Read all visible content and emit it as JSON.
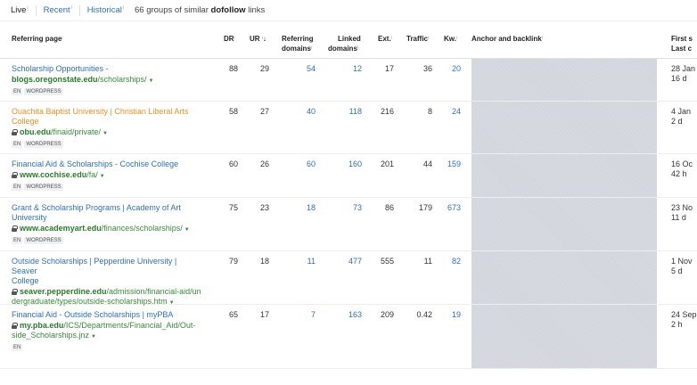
{
  "topbar": {
    "tabs": [
      {
        "label": "Live",
        "info": "i",
        "active": true
      },
      {
        "label": "Recent",
        "info": "i",
        "active": false
      },
      {
        "label": "Historical",
        "info": "i",
        "active": false
      }
    ],
    "summary_prefix": "66 groups of similar",
    "summary_bold": "dofollow",
    "summary_suffix": "links"
  },
  "columns": {
    "referring_page": "Referring page",
    "dr": "DR",
    "ur": "UR",
    "referring_domains_1": "Referring",
    "referring_domains_2": "domains",
    "linked_domains_1": "Linked",
    "linked_domains_2": "domains",
    "ext": "Ext.",
    "traffic": "Traffic",
    "kw": "Kw.",
    "anchor": "Anchor and backlink",
    "first_seen_1": "First s",
    "first_seen_2": "Last c",
    "info": "i",
    "sort_arrow": "↓"
  },
  "rows": [
    {
      "title_lines": [
        "Scholarship Opportunities -"
      ],
      "title_color": "blue",
      "secure": false,
      "url_bold": "blogs.oregonstate.edu",
      "url_rest_lines": [
        "/scholarships/"
      ],
      "tags": [
        "EN",
        "WORDPRESS"
      ],
      "dr": "88",
      "ur": "29",
      "ref_domains": "54",
      "linked_domains": "12",
      "ext": "17",
      "traffic": "36",
      "kw": "20",
      "first_seen": "28 Jan",
      "last_checked": "16 d"
    },
    {
      "title_lines": [
        "Ouachita Baptist University | Christian Liberal Arts",
        "College"
      ],
      "title_color": "orange",
      "secure": true,
      "url_bold": "obu.edu",
      "url_rest_lines": [
        "/finaid/private/"
      ],
      "tags": [
        "EN",
        "WORDPRESS"
      ],
      "dr": "58",
      "ur": "27",
      "ref_domains": "40",
      "linked_domains": "118",
      "ext": "216",
      "traffic": "8",
      "kw": "24",
      "first_seen": "4 Jan",
      "last_checked": "2 d"
    },
    {
      "title_lines": [
        "Financial Aid & Scholarships - Cochise College"
      ],
      "title_color": "blue",
      "secure": true,
      "url_bold": "www.cochise.edu",
      "url_rest_lines": [
        "/fa/"
      ],
      "tags": [
        "EN",
        "WORDPRESS"
      ],
      "dr": "60",
      "ur": "26",
      "ref_domains": "60",
      "linked_domains": "160",
      "ext": "201",
      "traffic": "44",
      "kw": "159",
      "first_seen": "16 Oc",
      "last_checked": "42 h"
    },
    {
      "title_lines": [
        "Grant & Scholarship Programs | Academy of Art",
        "University"
      ],
      "title_color": "blue",
      "secure": true,
      "url_bold": "www.academyart.edu",
      "url_rest_lines": [
        "/finances/scholarships/"
      ],
      "tags": [
        "EN",
        "WORDPRESS"
      ],
      "dr": "75",
      "ur": "23",
      "ref_domains": "18",
      "linked_domains": "73",
      "ext": "86",
      "traffic": "179",
      "kw": "673",
      "first_seen": "23 No",
      "last_checked": "11 d"
    },
    {
      "title_lines": [
        "Outside Scholarships | Pepperdine University | Seaver",
        "College"
      ],
      "title_color": "blue",
      "secure": true,
      "url_bold": "seaver.pepperdine.edu",
      "url_rest_lines": [
        "/admission/financial-aid/un",
        "dergraduate/types/outside-scholarships.htm"
      ],
      "tags": [],
      "dr": "79",
      "ur": "18",
      "ref_domains": "11",
      "linked_domains": "477",
      "ext": "555",
      "traffic": "11",
      "kw": "82",
      "first_seen": "1 Nov",
      "last_checked": "5 d"
    },
    {
      "title_lines": [
        "Financial Aid - Outside Scholarships | myPBA"
      ],
      "title_color": "blue",
      "secure": true,
      "url_bold": "my.pba.edu",
      "url_rest_lines": [
        "/ICS/Departments/Financial_Aid/Out-",
        "side_Scholarships.jnz"
      ],
      "tags": [
        "EN"
      ],
      "dr": "65",
      "ur": "17",
      "ref_domains": "7",
      "linked_domains": "163",
      "ext": "209",
      "traffic": "0.42",
      "kw": "19",
      "first_seen": "24 Sep",
      "last_checked": "2 h"
    }
  ],
  "colors": {
    "link": "#2f6fb5",
    "url": "#3a8a3a",
    "visited_title": "#e8912d",
    "anchor_panel": "#d3d6dc"
  }
}
